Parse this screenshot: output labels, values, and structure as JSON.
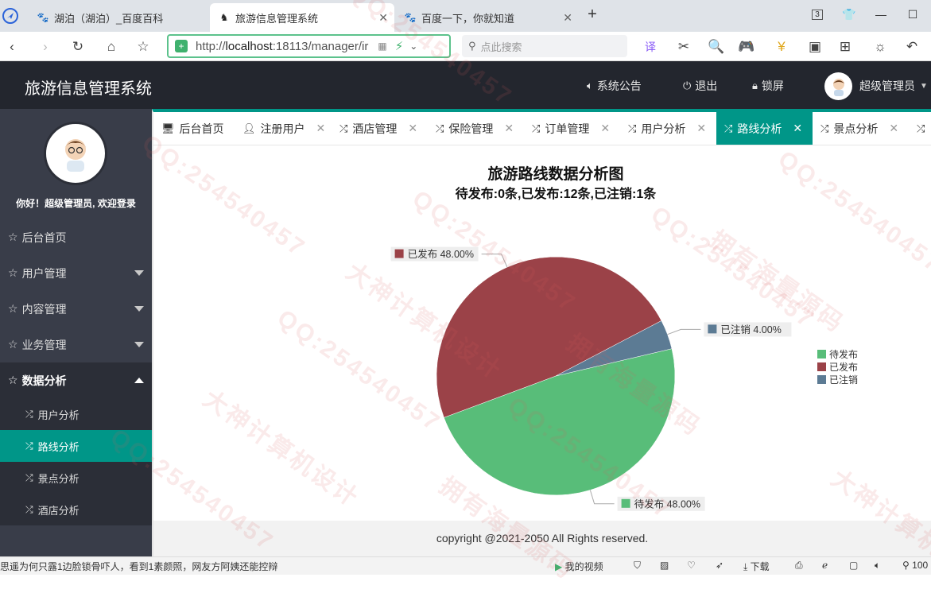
{
  "browser": {
    "tabs": [
      {
        "label": "湖泊（湖泊）_百度百科",
        "icon": "baidu-paw-icon",
        "active": false
      },
      {
        "label": "旅游信息管理系统",
        "icon": "horse-icon",
        "active": true
      },
      {
        "label": "百度一下，你就知道",
        "icon": "baidu-paw-icon",
        "active": false
      }
    ],
    "tab_count": "3",
    "url_prefix": "http://",
    "url_host": "localhost",
    "url_rest": ":18113/manager/ir",
    "search_placeholder": "点此搜索"
  },
  "header": {
    "title": "旅游信息管理系统",
    "announcement": "系统公告",
    "logout": "退出",
    "lock": "锁屏",
    "user": "超级管理员"
  },
  "sidebar": {
    "welcome": "你好！超级管理员, 欢迎登录",
    "menus": [
      {
        "label": "后台首页"
      },
      {
        "label": "用户管理"
      },
      {
        "label": "内容管理"
      },
      {
        "label": "业务管理"
      },
      {
        "label": "数据分析"
      }
    ],
    "submenus": [
      {
        "label": "用户分析"
      },
      {
        "label": "路线分析"
      },
      {
        "label": "景点分析"
      },
      {
        "label": "酒店分析"
      }
    ]
  },
  "page_tabs": [
    {
      "label": "后台首页"
    },
    {
      "label": "注册用户"
    },
    {
      "label": "酒店管理"
    },
    {
      "label": "保险管理"
    },
    {
      "label": "订单管理"
    },
    {
      "label": "用户分析"
    },
    {
      "label": "路线分析"
    },
    {
      "label": "景点分析"
    }
  ],
  "chart_data": {
    "type": "pie",
    "title": "旅游路线数据分析图",
    "subtitle": "待发布:0条,已发布:12条,已注销:1条",
    "slices": [
      {
        "name": "待发布",
        "value": 48.0,
        "label": "待发布 48.00%",
        "color": "#58bd79"
      },
      {
        "name": "已发布",
        "value": 48.0,
        "label": "已发布 48.00%",
        "color": "#9b4248"
      },
      {
        "name": "已注销",
        "value": 4.0,
        "label": "已注销 4.00%",
        "color": "#5c7b94"
      }
    ],
    "legend": [
      "待发布",
      "已发布",
      "已注销"
    ],
    "legend_position": "right"
  },
  "footer": "copyright @2021-2050 All Rights reserved.",
  "statusbar": {
    "news": "思遥为何只露1边脸锁骨吓人，看到1素颜照，网友方阿姨还能控辩",
    "video": "我的视频",
    "download": "下载",
    "zoom": "100"
  },
  "watermarks": [
    "QQ:254540457",
    "大神计算机设计",
    "拥有海量源码"
  ]
}
